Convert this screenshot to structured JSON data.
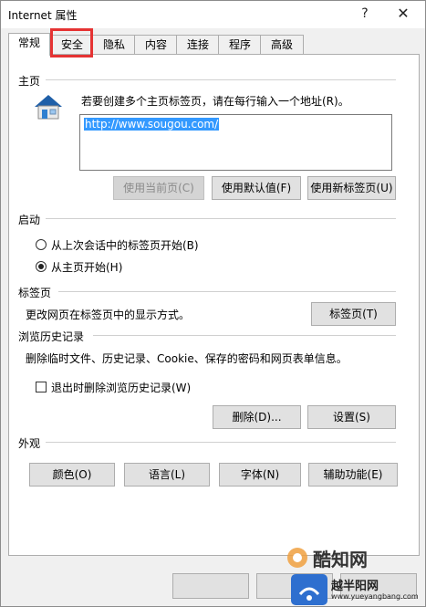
{
  "window": {
    "title": "Internet 属性",
    "help": "?",
    "close": "✕"
  },
  "tabs": [
    "常规",
    "安全",
    "隐私",
    "内容",
    "连接",
    "程序",
    "高级"
  ],
  "home": {
    "section": "主页",
    "desc": "若要创建多个主页标签页，请在每行输入一个地址(R)。",
    "url": "http://www.sougou.com/",
    "buttons": [
      "使用当前页(C)",
      "使用默认值(F)",
      "使用新标签页(U)"
    ]
  },
  "startup": {
    "section": "启动",
    "options": [
      "从上次会话中的标签页开始(B)",
      "从主页开始(H)"
    ]
  },
  "tabsection": {
    "section": "标签页",
    "desc": "更改网页在标签页中的显示方式。",
    "button": "标签页(T)"
  },
  "history": {
    "section": "浏览历史记录",
    "desc": "删除临时文件、历史记录、Cookie、保存的密码和网页表单信息。",
    "checkbox": "退出时删除浏览历史记录(W)",
    "delete": "删除(D)...",
    "settings": "设置(S)"
  },
  "appearance": {
    "section": "外观",
    "buttons": [
      "颜色(O)",
      "语言(L)",
      "字体(N)",
      "辅助功能(E)"
    ]
  },
  "watermark": {
    "brand": "酷知网",
    "site": "www.yueyangbang.com",
    "site_name": "越半阳网"
  },
  "colors": {
    "highlight": "#e53333",
    "selection": "#3399ff",
    "house_roof": "#1f5fa8"
  }
}
